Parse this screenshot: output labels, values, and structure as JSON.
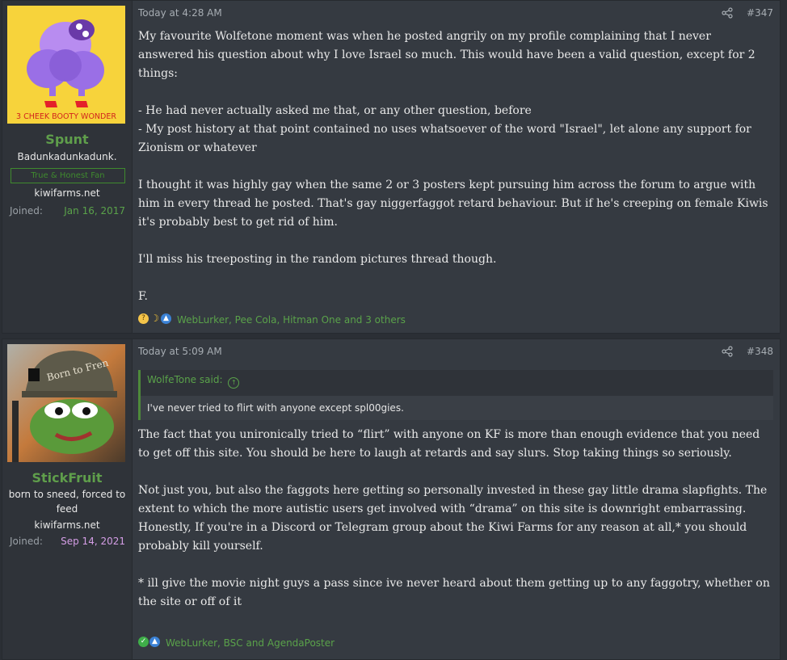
{
  "posts": [
    {
      "username": "Spunt",
      "user_title": "Badunkadunkadunk.",
      "banner": "True & Honest Fan",
      "site": "kiwifarms.net",
      "joined_label": "Joined:",
      "joined_date": "Jan 16, 2017",
      "joined_color": "#5aa24a",
      "avatar_caption": "3 CHEEK BOOTY WONDER",
      "time": "Today at 4:28 AM",
      "post_number": "#347",
      "paragraphs": [
        "My favourite Wolfetone moment was when he posted angrily on my profile complaining that I never answered his question about why I love Israel so much. This would have been a valid question, except for 2 things:",
        "- He had never actually asked me that, or any other question, before\n- My post history at that point contained no uses whatsoever of the word \"Israel\", let alone any support for Zionism or whatever",
        "I thought it was highly gay when the same 2 or 3 posters kept pursuing him across the forum to argue with him in every thread he posted. That's gay niggerfaggot retard behaviour. But if he's creeping on female Kiwis it's probably best to get rid of him.",
        "I'll miss his treeposting in the random pictures thread though.",
        "F."
      ],
      "reactions": "WebLurker, Pee Cola, Hitman One and 3 others",
      "reaction_icons": [
        "thinking-emoji-icon",
        "moon-icon",
        "thumbs-up-icon"
      ]
    },
    {
      "username": "StickFruit",
      "user_title": "born to sneed, forced to feed",
      "site": "kiwifarms.net",
      "joined_label": "Joined:",
      "joined_date": "Sep 14, 2021",
      "joined_color": "#d59ee6",
      "avatar_helmet_text": "Born to Fren",
      "time": "Today at 5:09 AM",
      "post_number": "#348",
      "quote": {
        "author": "WolfeTone said:",
        "text": "I've never tried to flirt with anyone except spl00gies."
      },
      "paragraphs": [
        "The fact that you unironically tried to “flirt” with anyone on KF is more than enough evidence that you need to get off this site. You should be here to laugh at retards and say slurs. Stop taking things so seriously.",
        "Not just you, but also the faggots here getting so personally invested in these gay little drama slapfights. The extent to which the more autistic users get involved with “drama” on this site is downright embarrassing. Honestly, If you're in a Discord or Telegram group about the Kiwi Farms for any reason at all,* you should probably kill yourself.",
        "* ill give the movie night guys a pass since ive never heard about them getting up to any faggotry, whether on the site or off of it"
      ],
      "reactions": "WebLurker, BSC and AgendaPoster",
      "reaction_icons": [
        "checkmark-icon",
        "thumbs-up-icon"
      ]
    }
  ]
}
